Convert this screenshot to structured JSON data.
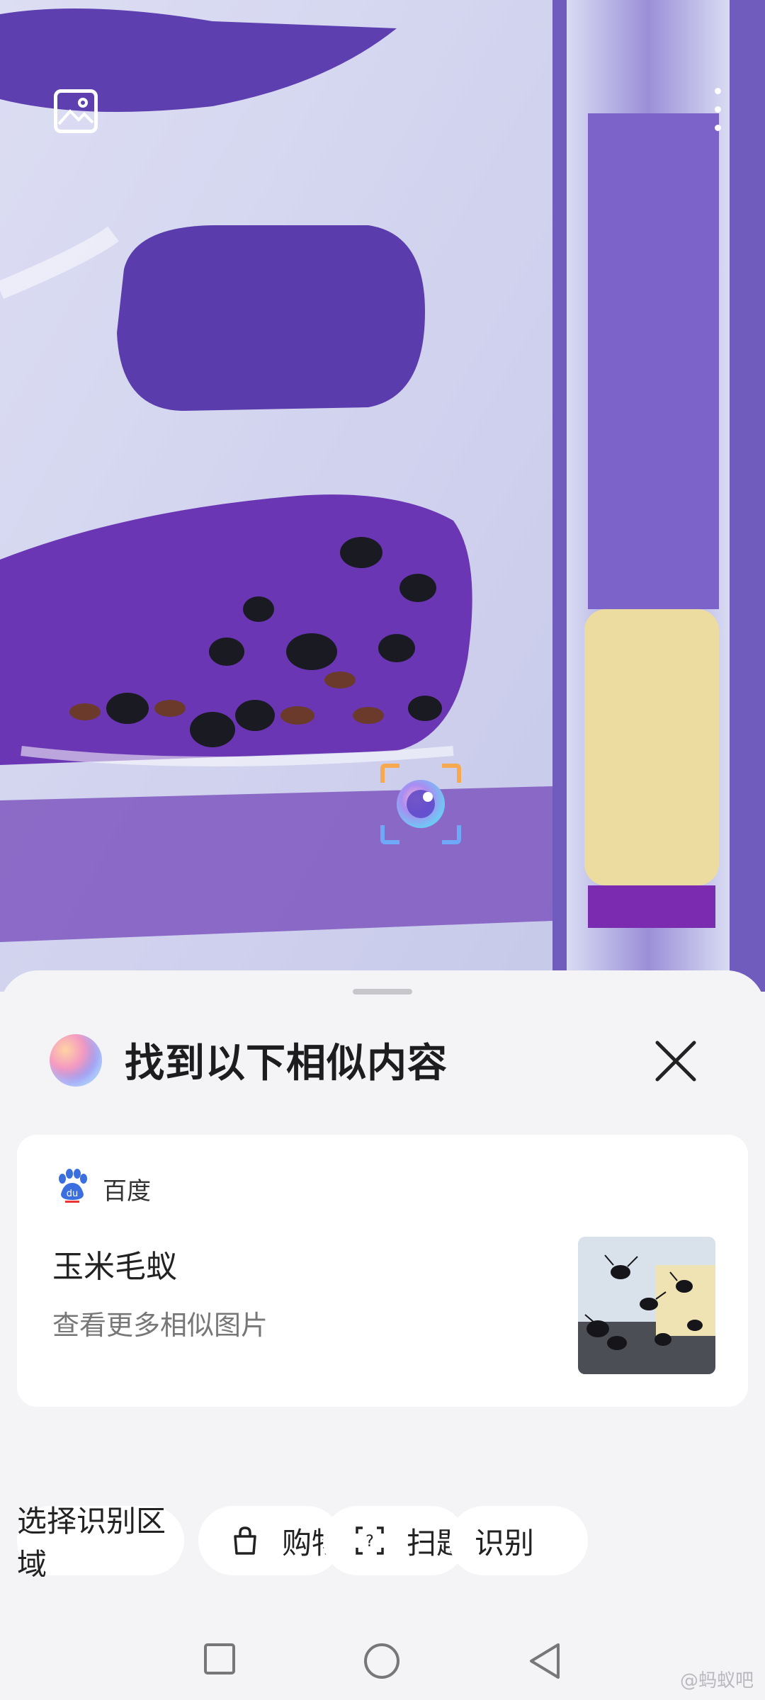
{
  "photo": {
    "top_left_icon": "gallery-icon",
    "top_right_icon": "more-vertical-icon",
    "lens_icon": "visual-search-lens-icon"
  },
  "sheet": {
    "title": "找到以下相似内容",
    "close_icon": "close-icon",
    "result": {
      "source_name": "百度",
      "source_icon": "baidu-paw-icon",
      "title": "玉米毛蚁",
      "subtitle": "查看更多相似图片"
    },
    "chips": [
      {
        "label": "选择识别区域",
        "icon": ""
      },
      {
        "label": "购物",
        "icon": "shopping-bag-icon"
      },
      {
        "label": "扫题",
        "icon": "scan-question-icon"
      },
      {
        "label": "识别",
        "icon": ""
      }
    ]
  },
  "navbar": {
    "recent_icon": "square-recent-icon",
    "home_icon": "circle-home-icon",
    "back_icon": "triangle-back-icon"
  },
  "watermark": "@蚂蚁吧"
}
